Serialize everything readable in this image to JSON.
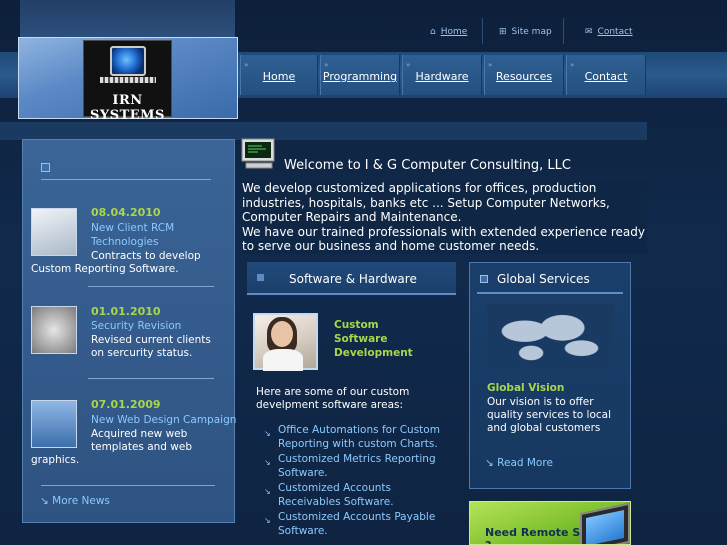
{
  "top_links": [
    {
      "label": "Home",
      "icon": "home-icon"
    },
    {
      "label": "Site map",
      "icon": "sitemap-icon"
    },
    {
      "label": "Contact",
      "icon": "contact-icon"
    }
  ],
  "logo": {
    "text": "IRN SYSTEMS"
  },
  "nav": [
    {
      "label": "Home"
    },
    {
      "label": "Programming"
    },
    {
      "label": "Hardware"
    },
    {
      "label": "Resources"
    },
    {
      "label": "Contact"
    }
  ],
  "news": {
    "items": [
      {
        "date": "08.04.2010",
        "title": "New Client RCM Technologies",
        "body_line1": "Contracts to develop",
        "body_line2": "Custom Reporting Software."
      },
      {
        "date": "01.01.2010",
        "title": "Security Revision",
        "body_line1": "Revised current clients",
        "body_line2": "on sercurity status."
      },
      {
        "date": "07.01.2009",
        "title": "New Web Design Campaign",
        "body_line1": "Acquired new web",
        "body_line2": "templates and web",
        "body_line3": "graphics."
      }
    ],
    "more_label": "More News"
  },
  "welcome": {
    "title": "Welcome to I & G Computer Consulting, LLC",
    "paragraph1": "We develop customized applications for offices, production industries, hospitals, banks etc ... Setup Computer Networks, Computer Repairs and Maintenance.",
    "paragraph2": "We have our trained professionals with extended experience ready to serve our business and home customer needs."
  },
  "software": {
    "heading": "Software & Hardware",
    "title": "Custom Software Development",
    "intro": "Here are some of our custom develpment software areas:",
    "items": [
      "Office Automations for Custom Reporting with custom Charts.",
      "Customized Metrics Reporting Software.",
      "Customized Accounts Receivables Software.",
      "Customized Accounts Payable Software."
    ]
  },
  "global": {
    "heading": "Global Services",
    "title": "Global Vision",
    "text": "Our vision is to offer quality services to local and global customers",
    "read_more": "Read More"
  },
  "remote": {
    "text": "Need Remote Services ?"
  },
  "colors": {
    "accent_green": "#a9d64a",
    "link_blue": "#8cc9ff",
    "background": "#0f2442"
  }
}
